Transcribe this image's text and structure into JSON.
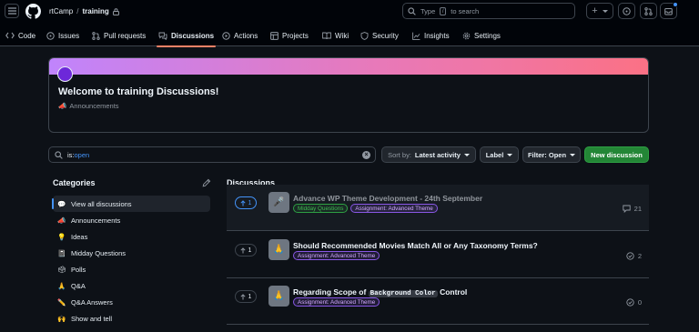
{
  "header": {
    "owner": "rtCamp",
    "separator": "/",
    "repo": "training",
    "search_prefix": "Type",
    "search_key": "/",
    "search_suffix": "to search",
    "new_button": "+"
  },
  "repo_nav": {
    "items": [
      {
        "label": "Code",
        "icon": "code-icon"
      },
      {
        "label": "Issues",
        "icon": "issue-icon"
      },
      {
        "label": "Pull requests",
        "icon": "pull-request-icon"
      },
      {
        "label": "Discussions",
        "icon": "discussion-icon",
        "active": true
      },
      {
        "label": "Actions",
        "icon": "play-icon"
      },
      {
        "label": "Projects",
        "icon": "table-icon"
      },
      {
        "label": "Wiki",
        "icon": "book-icon"
      },
      {
        "label": "Security",
        "icon": "shield-icon"
      },
      {
        "label": "Insights",
        "icon": "graph-icon"
      },
      {
        "label": "Settings",
        "icon": "gear-icon"
      }
    ]
  },
  "welcome": {
    "title": "Welcome to training Discussions!",
    "category_emoji": "📣",
    "category": "Announcements"
  },
  "filter": {
    "query_key": "is:",
    "query_value": "open",
    "sort_prefix": "Sort by:",
    "sort_value": "Latest activity",
    "label_button": "Label",
    "filter_button": "Filter: Open",
    "new_discussion": "New discussion"
  },
  "categories": {
    "title": "Categories",
    "items": [
      {
        "emoji": "💬",
        "label": "View all discussions",
        "active": true
      },
      {
        "emoji": "📣",
        "label": "Announcements"
      },
      {
        "emoji": "💡",
        "label": "Ideas"
      },
      {
        "emoji": "📓",
        "label": "Midday Questions"
      },
      {
        "emoji": "🗳",
        "label": "Polls"
      },
      {
        "emoji": "🙏",
        "label": "Q&A"
      },
      {
        "emoji": "✏️",
        "label": "Q&A Answers"
      },
      {
        "emoji": "🙌",
        "label": "Show and tell"
      }
    ]
  },
  "discussions": {
    "title": "Discussions",
    "rows": [
      {
        "votes": "1",
        "avatar": "🎤",
        "title_parts": [
          "Advance WP Theme Development - 24th September"
        ],
        "labels": [
          {
            "text": "Midday Questions",
            "color": "green"
          },
          {
            "text": "Assignment: Advanced Theme",
            "color": "purple"
          }
        ],
        "stat": "21",
        "stat_icon": "comment-icon"
      },
      {
        "votes": "1",
        "avatar": "🙏",
        "title_parts": [
          "Should Recommended Movies Match All or Any Taxonomy Terms?"
        ],
        "labels": [
          {
            "text": "Assignment: Advanced Theme",
            "color": "purple"
          }
        ],
        "stat": "2",
        "stat_icon": "check-circle-icon"
      },
      {
        "votes": "1",
        "avatar": "🙏",
        "title_before": "Regarding Scope of",
        "title_code": "Background Color",
        "title_after": "Control",
        "labels": [
          {
            "text": "Assignment: Advanced Theme",
            "color": "purple"
          }
        ],
        "stat": "0",
        "stat_icon": "check-circle-icon"
      }
    ]
  },
  "colors": {
    "accent_blue": "#4493f8",
    "primary_green": "#238636",
    "tab_underline": "#f78166",
    "background": "#0d1117"
  }
}
